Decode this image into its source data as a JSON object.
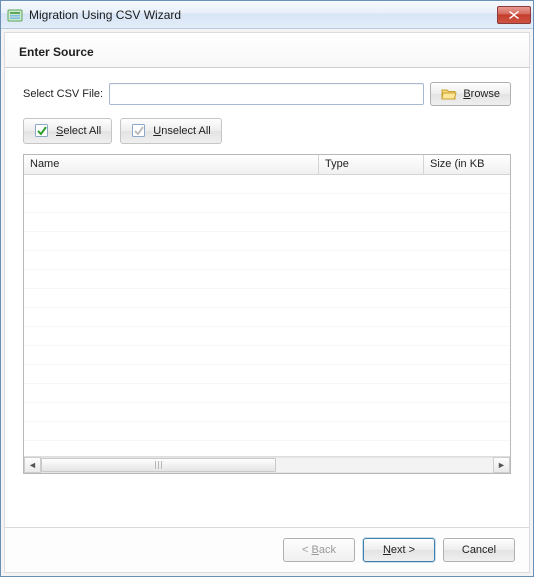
{
  "window": {
    "title": "Migration Using CSV Wizard"
  },
  "header": {
    "step_title": "Enter Source"
  },
  "fileSelect": {
    "label": "Select CSV File:",
    "value": "",
    "browse_pre": "",
    "browse_u": "B",
    "browse_post": "rowse"
  },
  "selectButtons": {
    "selectAll_pre": "",
    "selectAll_u": "S",
    "selectAll_post": "elect All",
    "unselectAll_pre": "",
    "unselectAll_u": "U",
    "unselectAll_post": "nselect All"
  },
  "table": {
    "columns": {
      "name": "Name",
      "type": "Type",
      "size": "Size (in KB"
    },
    "rows": []
  },
  "footer": {
    "back_pre": "< ",
    "back_u": "B",
    "back_post": "ack",
    "next_pre": "",
    "next_u": "N",
    "next_post": "ext >",
    "cancel": "Cancel"
  }
}
